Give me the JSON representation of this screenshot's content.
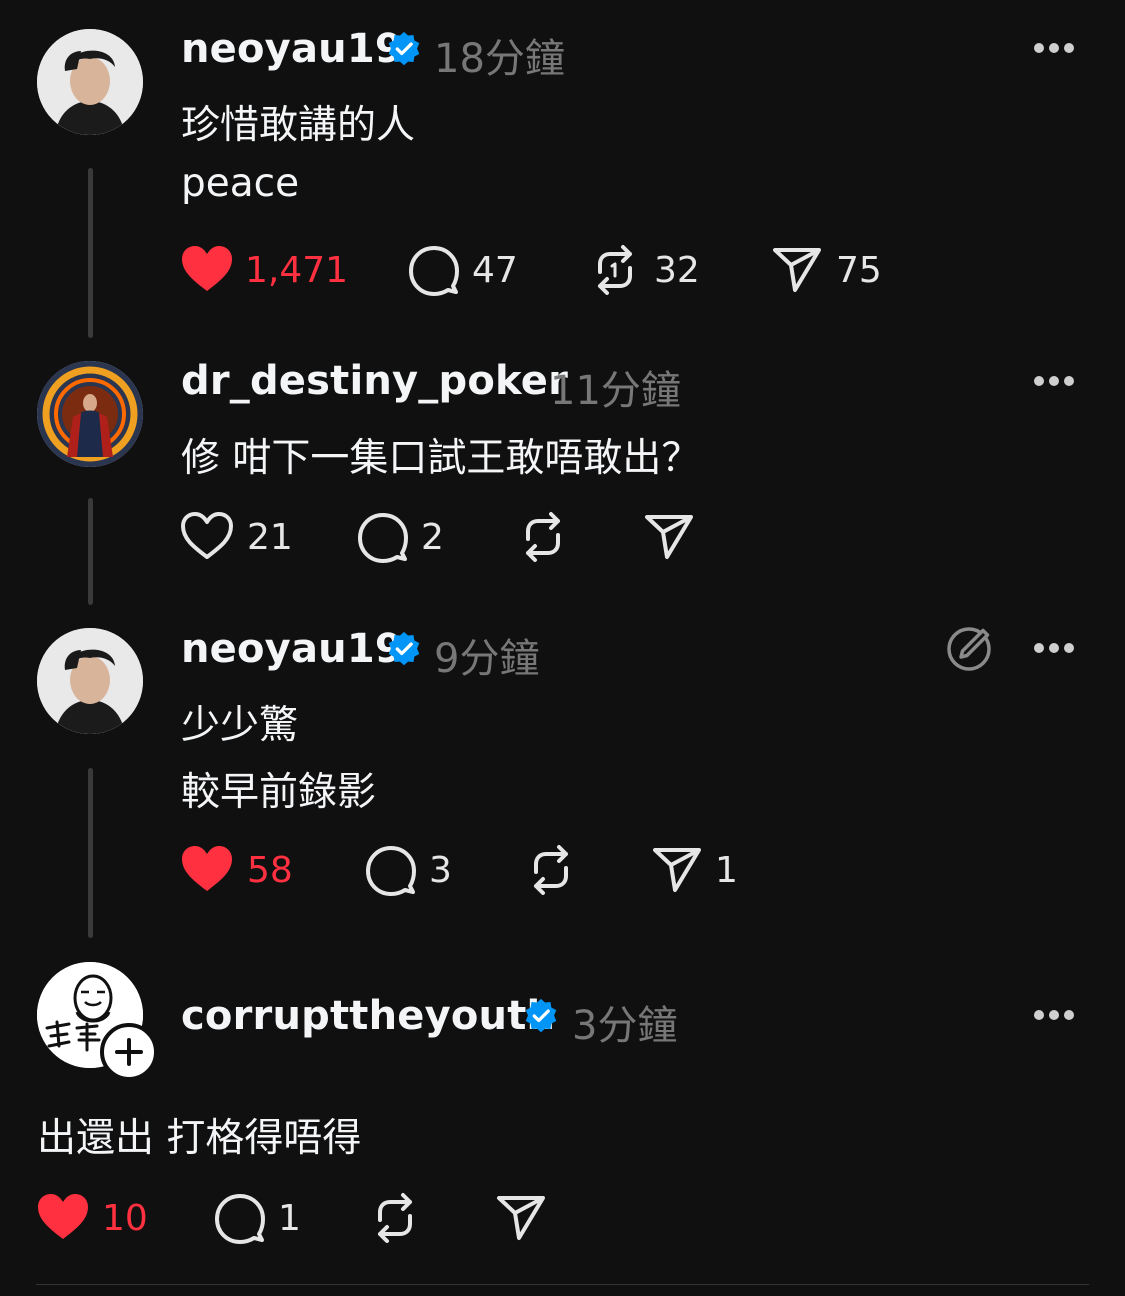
{
  "posts": [
    {
      "username": "neoyau19",
      "verified": true,
      "time": "18分鐘",
      "lines": [
        "珍惜敢講的人",
        "peace"
      ],
      "likes": "1,471",
      "liked": true,
      "replies": "47",
      "reposts": "32",
      "shares": "75"
    },
    {
      "username": "dr_destiny_poker",
      "verified": false,
      "time": "11分鐘",
      "lines": [
        "修 咁下一集口試王敢唔敢出？"
      ],
      "likes": "21",
      "liked": false,
      "replies": "2",
      "reposts": "",
      "shares": ""
    },
    {
      "username": "neoyau19",
      "verified": true,
      "time": "9分鐘",
      "lines": [
        "少少驚",
        "較早前錄影"
      ],
      "likes": "58",
      "liked": true,
      "replies": "3",
      "reposts": "",
      "shares": "1"
    },
    {
      "username": "corrupttheyouth",
      "verified": true,
      "time": "3分鐘",
      "lines": [
        "出還出 打格得唔得"
      ],
      "likes": "10",
      "liked": true,
      "replies": "1",
      "reposts": "",
      "shares": ""
    }
  ],
  "colors": {
    "background": "#101010",
    "like_red": "#ff3040",
    "verified_blue": "#0095f6",
    "muted": "#777777"
  },
  "icons": [
    "heart-icon",
    "comment-icon",
    "repost-icon",
    "share-icon",
    "verified-badge-icon",
    "more-icon",
    "edit-icon",
    "plus-icon"
  ]
}
